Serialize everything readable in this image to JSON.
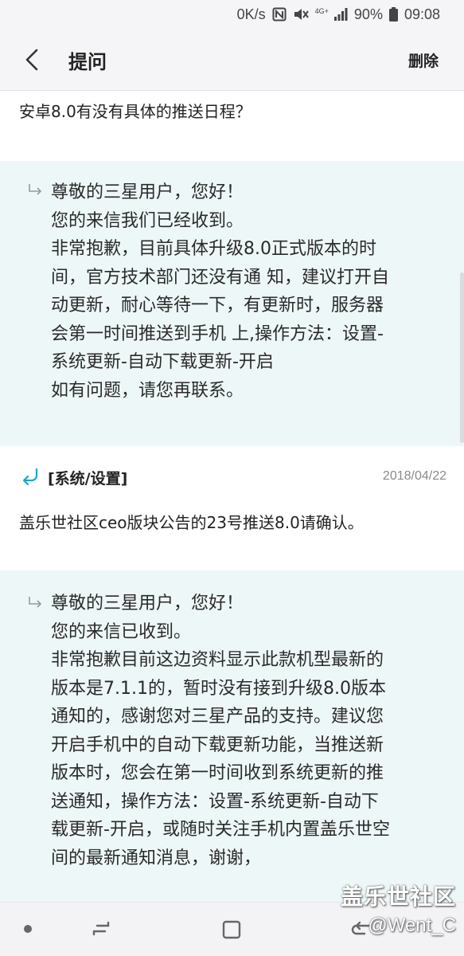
{
  "status_bar": {
    "speed": "0K/s",
    "network": "4G+",
    "battery": "90%",
    "time": "09:08",
    "icons": [
      "nfc-icon",
      "mute-icon",
      "signal-icon",
      "battery-icon"
    ]
  },
  "header": {
    "title": "提问",
    "delete_label": "删除",
    "back_icon": "chevron-left-icon"
  },
  "thread": {
    "question_1": "安卓8.0有没有具体的推送日程？",
    "reply_1": {
      "lines": [
        "尊敬的三星用户，您好！",
        "您的来信我们已经收到。",
        "非常抱歉，目前具体升级8.0正式版本的时",
        "间，官方技术部门还没有通 知，建议打开自",
        "动更新，耐心等待一下，有更新时，服务器",
        "会第一时间推送到手机 上,操作方法：设置-",
        "系统更新-自动下载更新-开启",
        "如有问题，请您再联系。"
      ]
    },
    "category": {
      "label": "[系统/设置]",
      "date": "2018/04/22"
    },
    "question_2": "盖乐世社区ceo版块公告的23号推送8.0请确认。",
    "reply_2": {
      "lines": [
        "尊敬的三星用户，您好！",
        "您的来信已收到。",
        "非常抱歉目前这边资料显示此款机型最新的",
        "版本是7.1.1的，暂时没有接到升级8.0版本",
        "通知的，感谢您对三星产品的支持。建议您",
        "开启手机中的自动下载更新功能，当推送新",
        "版本时，您会在第一时间收到系统更新的推",
        "送通知，操作方法：设置-系统更新-自动下",
        "载更新-开启，或随时关注手机内置盖乐世空",
        "间的最新通知消息，谢谢，"
      ]
    }
  },
  "watermark": {
    "line1": "盖乐世社区",
    "line2": "@Went_C"
  },
  "colors": {
    "reply_bg": "#eef7f7",
    "accent": "#1aa8c4",
    "header_bg": "#f5f5f7"
  }
}
